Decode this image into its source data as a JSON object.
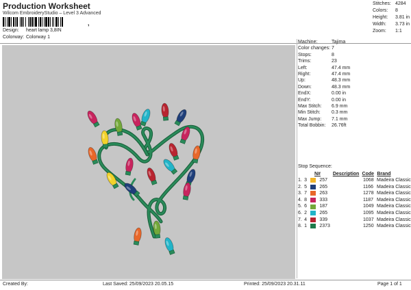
{
  "header": {
    "title": "Production Worksheet",
    "subtitle": "Wilcom EmbroideryStudio – Level 3 Advanced",
    "barcode_mark": ","
  },
  "meta": [
    {
      "label": "Design:",
      "value": "heart lamp 3,8IN"
    },
    {
      "label": "Colorway:",
      "value": "Colorway 1"
    }
  ],
  "stats": [
    {
      "label": "Stitches:",
      "value": "4284"
    },
    {
      "label": "Colors:",
      "value": "8"
    },
    {
      "label": "Height:",
      "value": "3.81 in"
    },
    {
      "label": "Width:",
      "value": "3.73 in"
    },
    {
      "label": "Zoom:",
      "value": "1:1"
    }
  ],
  "machine_info": [
    {
      "label": "Machine:",
      "value": "Tajima"
    },
    {
      "label": "Color changes:",
      "value": "7"
    },
    {
      "label": "Stops:",
      "value": "8"
    },
    {
      "label": "Trims:",
      "value": "23"
    },
    {
      "label": "Left:",
      "value": "47.4 mm"
    },
    {
      "label": "Right:",
      "value": "47.4 mm"
    },
    {
      "label": "Up:",
      "value": "48.3 mm"
    },
    {
      "label": "Down:",
      "value": "48.3 mm"
    },
    {
      "label": "EndX:",
      "value": "0.00 in"
    },
    {
      "label": "EndY:",
      "value": "0.00 in"
    },
    {
      "label": "Max Stitch:",
      "value": "6.9 mm"
    },
    {
      "label": "Min Stitch:",
      "value": "0.3 mm"
    },
    {
      "label": "Max Jump:",
      "value": "7.1 mm"
    },
    {
      "label": "Total Bobbin:",
      "value": "26.76ft"
    }
  ],
  "stop_sequence": {
    "title": "Stop Sequence:",
    "headers": {
      "n": "N#",
      "desc": "Description",
      "code": "Code",
      "brand": "Brand"
    },
    "rows": [
      {
        "num": "1.",
        "stop": "3",
        "color": "#f2b52a",
        "n": "257",
        "code": "1068",
        "brand": "Madeira Classic 40"
      },
      {
        "num": "2.",
        "stop": "5",
        "color": "#1f3f7a",
        "n": "265",
        "code": "1166",
        "brand": "Madeira Classic 40"
      },
      {
        "num": "3.",
        "stop": "7",
        "color": "#e8672a",
        "n": "263",
        "code": "1278",
        "brand": "Madeira Classic 40"
      },
      {
        "num": "4.",
        "stop": "8",
        "color": "#c8245e",
        "n": "333",
        "code": "1187",
        "brand": "Madeira Classic 40"
      },
      {
        "num": "5.",
        "stop": "6",
        "color": "#73a83a",
        "n": "187",
        "code": "1049",
        "brand": "Madeira Classic 40"
      },
      {
        "num": "6.",
        "stop": "2",
        "color": "#22b4c8",
        "n": "265",
        "code": "1095",
        "brand": "Madeira Classic 40"
      },
      {
        "num": "7.",
        "stop": "4",
        "color": "#b82430",
        "n": "339",
        "code": "1037",
        "brand": "Madeira Classic 40"
      },
      {
        "num": "8.",
        "stop": "1",
        "color": "#1e7a4a",
        "n": "2373",
        "code": "1250",
        "brand": "Madeira Classic 40"
      }
    ]
  },
  "footer": {
    "created_by": "Created By:",
    "last_saved": "Last Saved: 25/09/2023 20.05.15",
    "printed": "Printed: 25/09/2023 20.31.11",
    "page": "Page 1 of 1"
  },
  "design_colors": {
    "background": "#c6c6c6",
    "wire": "#2a8a5a",
    "wire_outline": "#155c36",
    "bulbs": [
      "#c8245e",
      "#73a83a",
      "#22b4c8",
      "#b82430",
      "#1f3f7a",
      "#f2d22a",
      "#e8672a",
      "#c8245e"
    ]
  }
}
